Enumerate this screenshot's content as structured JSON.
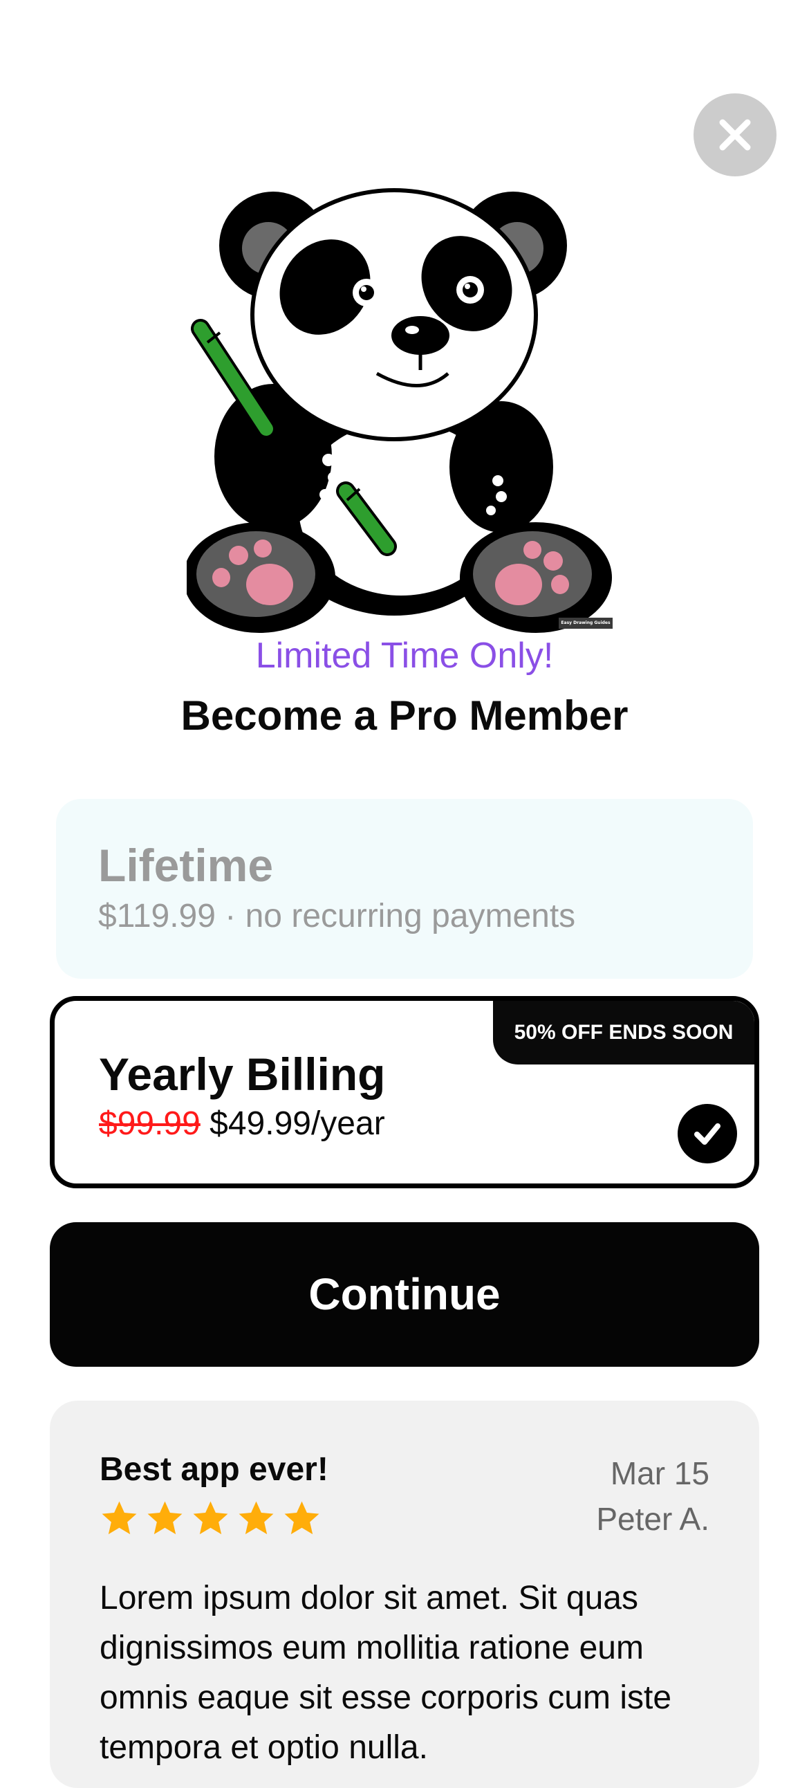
{
  "header": {
    "close_icon": "close-icon",
    "hero_image": "panda-illustration",
    "watermark_text": "Easy Drawing Guides"
  },
  "promo": {
    "tagline": "Limited Time Only!",
    "headline": "Become a Pro Member"
  },
  "plans": {
    "lifetime": {
      "title": "Lifetime",
      "subtitle": "$119.99 · no recurring payments",
      "selected": false
    },
    "yearly": {
      "badge": "50% OFF ENDS SOON",
      "title": "Yearly Billing",
      "old_price": "$99.99",
      "new_price": "$49.99/year",
      "selected": true,
      "check_icon": "checkmark-icon"
    }
  },
  "cta": {
    "label": "Continue"
  },
  "review": {
    "title": "Best app ever!",
    "rating": 5,
    "star_icon": "star-icon",
    "date": "Mar 15",
    "author": "Peter A.",
    "body": "Lorem ipsum dolor sit amet. Sit quas dignissimos eum mollitia ratione eum omnis eaque sit esse corporis cum iste tempora et optio nulla."
  },
  "colors": {
    "accent_purple": "#8a4fe6",
    "strike_red": "#ff1a1a",
    "star_gold": "#ffad0a",
    "lifetime_bg": "#f2fbfc",
    "review_bg": "#f1f1f1"
  }
}
